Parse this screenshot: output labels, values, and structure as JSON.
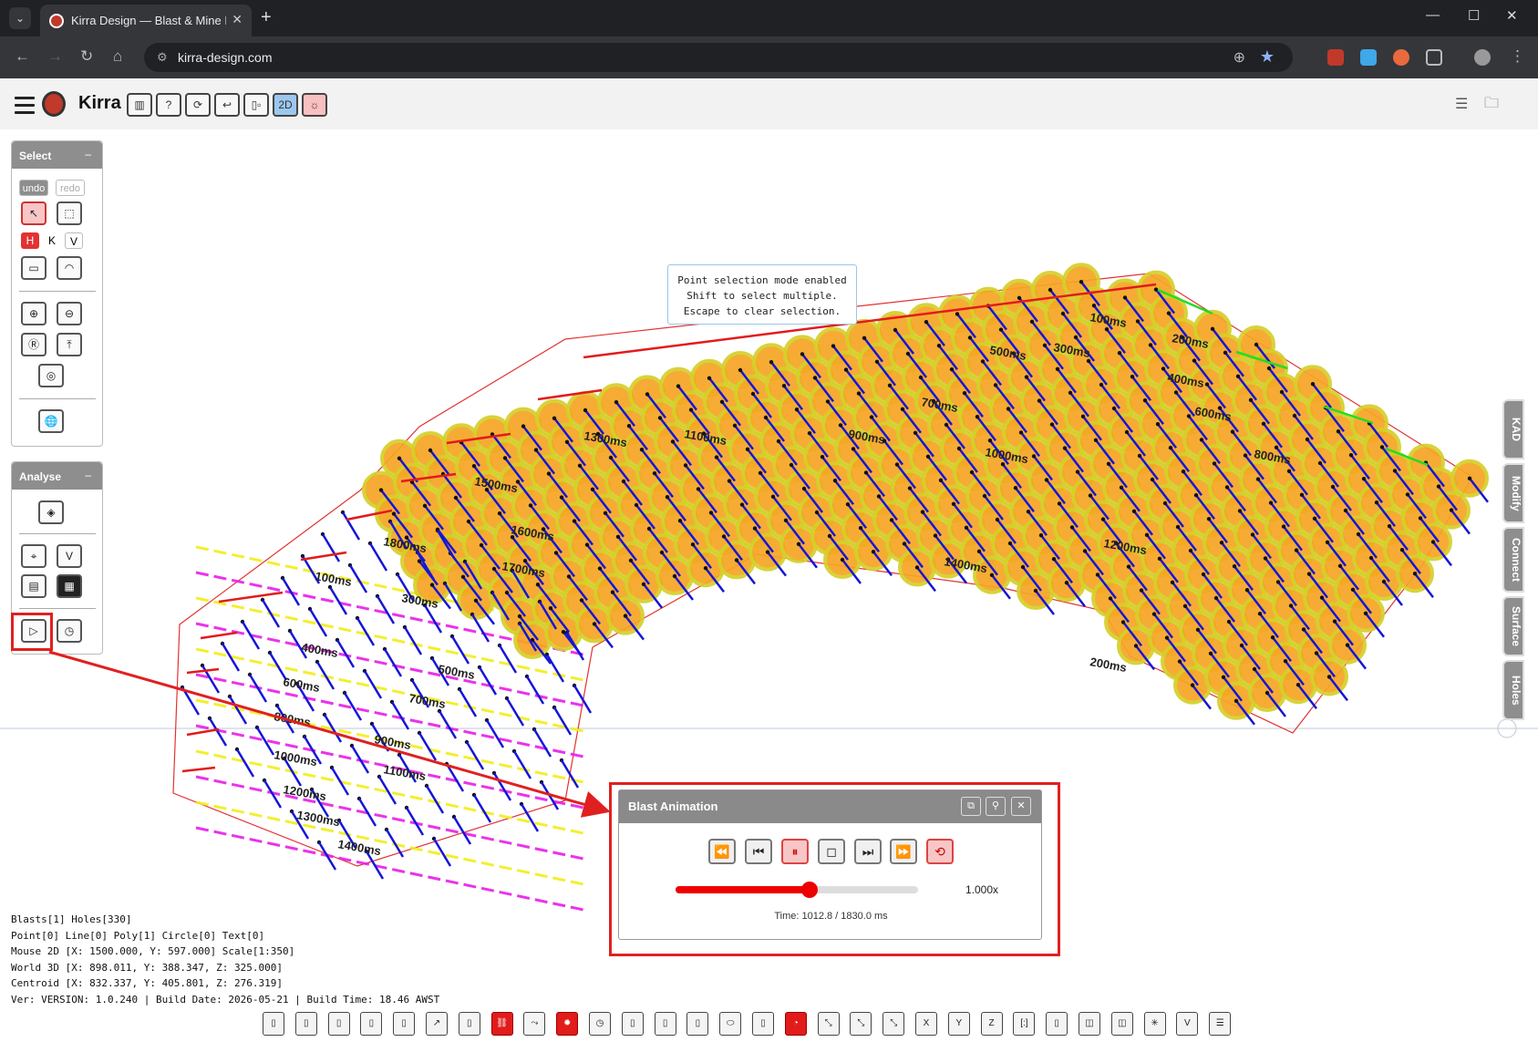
{
  "browser": {
    "tab_title": "Kirra Design — Blast & Mine De",
    "url": "kirra-design.com"
  },
  "app": {
    "name": "Kirra",
    "header_buttons": [
      "book-icon",
      "help-icon",
      "refresh-icon",
      "undo-arrow-icon",
      "layout-icon",
      "2D",
      "sun-icon"
    ],
    "hint_lines": [
      "Point selection mode enabled",
      "Shift to select multiple.",
      "Escape to clear selection."
    ]
  },
  "select_panel": {
    "title": "Select",
    "minimize": "–",
    "undo": "undo",
    "redo": "redo",
    "h": "H",
    "k": "K",
    "v": "V"
  },
  "analyse_panel": {
    "title": "Analyse",
    "minimize": "–"
  },
  "side_tabs": [
    "KAD",
    "Modify",
    "Connect",
    "Surface",
    "Holes"
  ],
  "status": {
    "line1": "Blasts[1] Holes[330]",
    "line2": "Point[0] Line[0] Poly[1] Circle[0] Text[0]",
    "line3": "Mouse 2D [X: 1500.000, Y: 597.000] Scale[1:350]",
    "line4": "World 3D [X: 898.011, Y: 388.347, Z: 325.000]",
    "line5": "Centroid [X: 832.337, Y: 405.801, Z: 276.319]",
    "line6": "Ver: VERSION: 1.0.240 | Build Date: 2026-05-21 | Build Time: 18.46 AWST"
  },
  "animation": {
    "title": "Blast Animation",
    "speed": "1.000x",
    "time": "Time: 1012.8 / 1830.0 ms",
    "progress": 0.553
  },
  "timing_labels": [
    "100ms",
    "200ms",
    "300ms",
    "400ms",
    "500ms",
    "600ms",
    "700ms",
    "800ms",
    "900ms",
    "1000ms",
    "1100ms",
    "1200ms",
    "1300ms",
    "1400ms",
    "1500ms",
    "1600ms",
    "1700ms",
    "1800ms"
  ],
  "colors": {
    "hole_fill": "#f6a623",
    "hole_ring": "#d4d02a",
    "tie_red": "#e21b1b",
    "tie_blue": "#1515d8",
    "contour_yellow": "#f2ee1a",
    "contour_magenta": "#e81ee8",
    "boundary": "#e23232"
  }
}
